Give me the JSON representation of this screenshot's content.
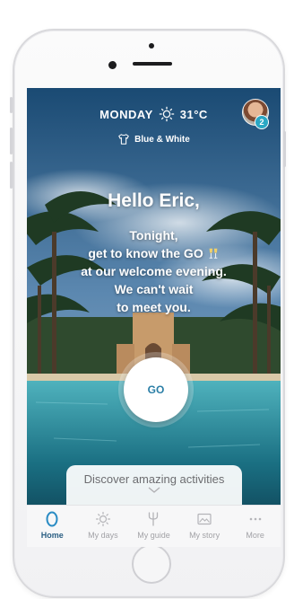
{
  "status": {
    "day": "MONDAY",
    "temperature": "31°C",
    "weather_icon": "sun-icon",
    "notifications": "2"
  },
  "dress_code": {
    "icon": "tshirt-icon",
    "label": "Blue & White"
  },
  "greeting": {
    "hello": "Hello Eric,",
    "lines": [
      "Tonight,",
      "get to know the GO",
      "at our welcome evening.",
      "We can't wait",
      "to meet you."
    ]
  },
  "go_button": {
    "label": "GO"
  },
  "discover": {
    "label": "Discover amazing activities"
  },
  "tabs": [
    {
      "label": "Home",
      "icon": "home-icon",
      "active": true
    },
    {
      "label": "My days",
      "icon": "sun-icon",
      "active": false
    },
    {
      "label": "My guide",
      "icon": "trident-icon",
      "active": false
    },
    {
      "label": "My story",
      "icon": "photo-icon",
      "active": false
    },
    {
      "label": "More",
      "icon": "more-icon",
      "active": false
    }
  ],
  "colors": {
    "accent": "#2b5f83",
    "go_text": "#2a7ea6",
    "badge": "#2aa7c4"
  }
}
